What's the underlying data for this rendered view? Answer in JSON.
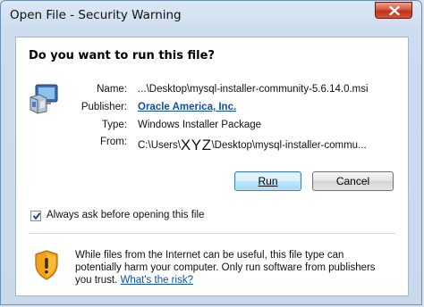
{
  "window": {
    "title": "Open File - Security Warning"
  },
  "dialog": {
    "question": "Do you want to run this file?",
    "fields": {
      "name_label": "Name:",
      "name_value": "...\\Desktop\\mysql-installer-community-5.6.14.0.msi",
      "publisher_label": "Publisher:",
      "publisher_value": "Oracle America, Inc.",
      "type_label": "Type:",
      "type_value": "Windows Installer Package",
      "from_label": "From:",
      "from_prefix": "C:\\Users\\",
      "from_user": "XYZ",
      "from_suffix": "\\Desktop\\mysql-installer-commu..."
    },
    "buttons": {
      "run": "Run",
      "cancel": "Cancel"
    },
    "checkbox": {
      "label": "Always ask before opening this file",
      "checked": true
    },
    "warning": {
      "text": "While files from the Internet can be useful, this file type can potentially harm your computer. Only run software from publishers you trust.",
      "link": "What's the risk?"
    }
  },
  "icons": {
    "close": "close-icon",
    "package": "installer-package-icon",
    "shield": "security-shield-icon",
    "check": "checkmark-icon"
  },
  "colors": {
    "link": "#0b4fb3",
    "close_button": "#c0331a",
    "shield": "#f0a21b"
  }
}
